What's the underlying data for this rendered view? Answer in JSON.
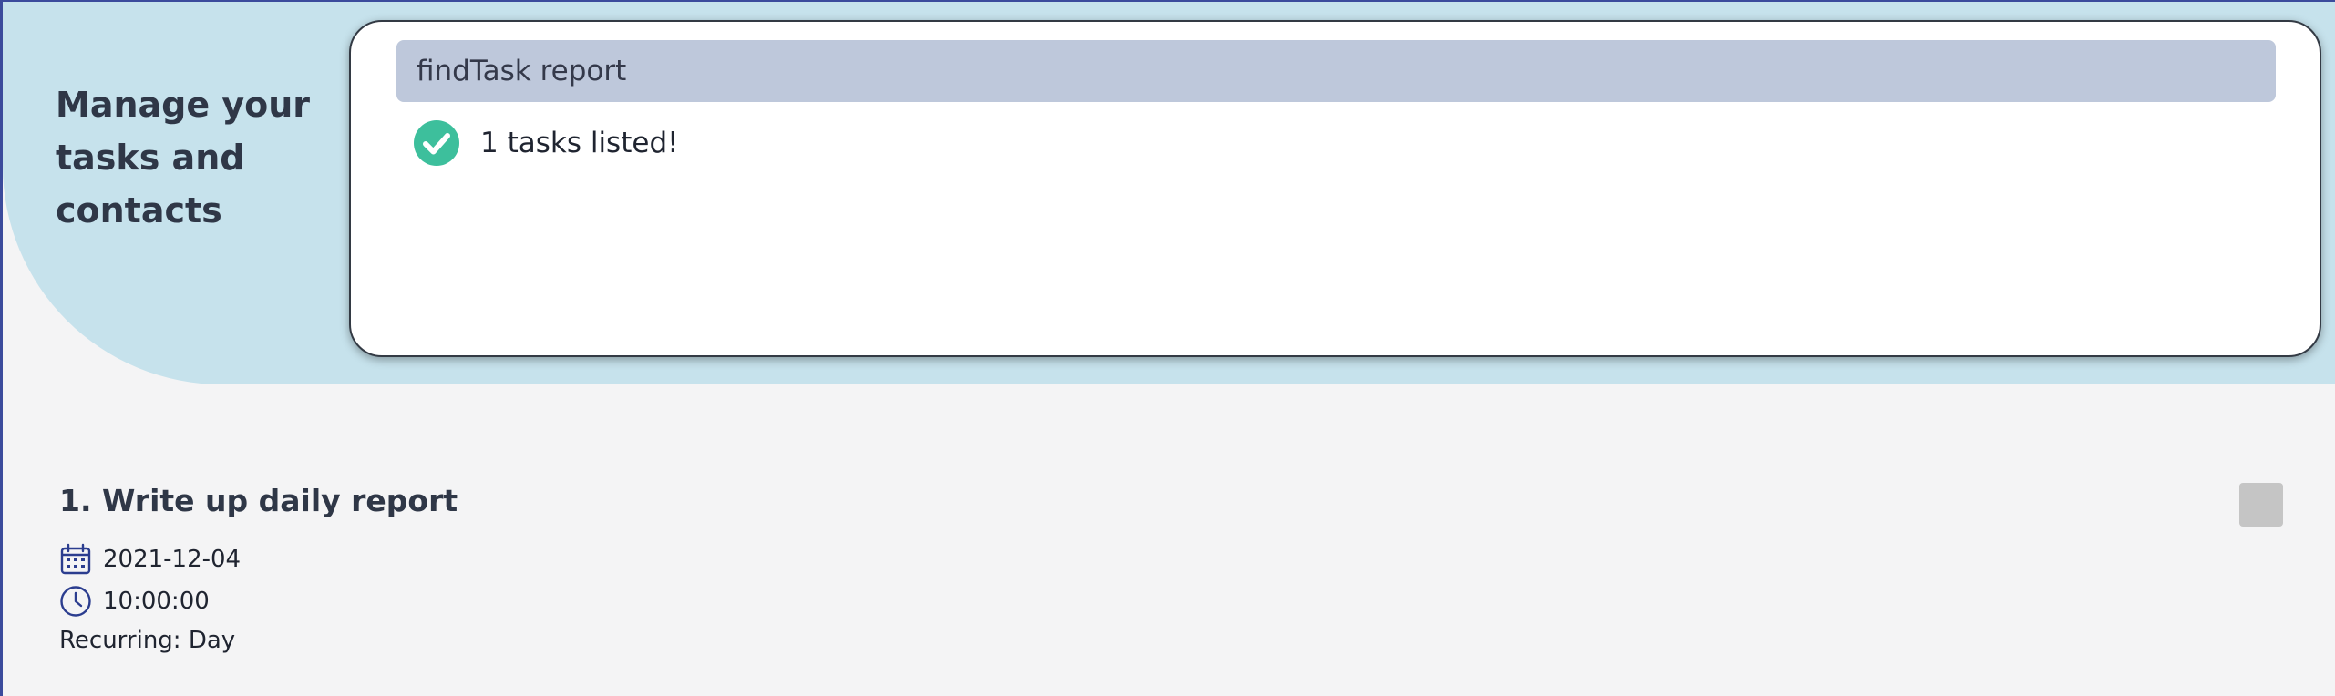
{
  "header": {
    "tagline": "Manage your tasks and contacts"
  },
  "command": {
    "input_value": "findTask report"
  },
  "result": {
    "message": "1 tasks listed!",
    "icon": "check-circle-icon",
    "icon_color": "#3dbf9c"
  },
  "tasks": [
    {
      "title": "1. Write up daily report",
      "date": "2021-12-04",
      "time": "10:00:00",
      "recurring": "Recurring: Day",
      "date_icon": "calendar-icon",
      "time_icon": "clock-icon"
    }
  ],
  "colors": {
    "header_band": "#c6e2ec",
    "command_box": "#bec8db",
    "background": "#f4f4f5",
    "icon_accent": "#2b3d8f",
    "checkbox": "#c5c5c5"
  }
}
